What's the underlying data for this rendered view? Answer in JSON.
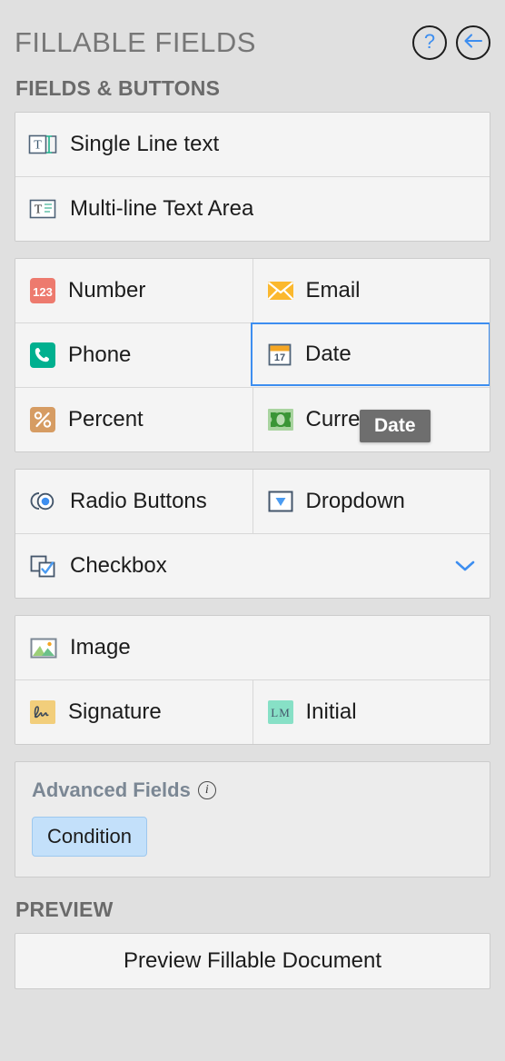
{
  "header": {
    "title": "FILLABLE FIELDS",
    "help_icon": "question-mark-icon",
    "help_label": "?",
    "back_icon": "back-arrow-icon"
  },
  "sections": {
    "fields_buttons_heading": "FIELDS & BUTTONS",
    "preview_heading": "PREVIEW"
  },
  "fields": {
    "single_line_text": {
      "label": "Single Line text",
      "icon": "single-line-text-icon"
    },
    "multi_line_text": {
      "label": "Multi-line Text Area",
      "icon": "multi-line-text-icon"
    },
    "number": {
      "label": "Number",
      "icon": "number-123-icon",
      "color": "#ED7A6E"
    },
    "email": {
      "label": "Email",
      "icon": "envelope-icon",
      "color": "#FBB82E"
    },
    "phone": {
      "label": "Phone",
      "icon": "phone-icon",
      "color": "#00B08F"
    },
    "date": {
      "label": "Date",
      "icon": "calendar-icon",
      "color": "#F5A623",
      "selected": true
    },
    "percent": {
      "label": "Percent",
      "icon": "percent-icon",
      "color": "#D69C63"
    },
    "currency": {
      "label": "Currency",
      "icon": "banknote-icon",
      "color": "#A9D4A0"
    },
    "radio": {
      "label": "Radio Buttons",
      "icon": "radio-button-icon"
    },
    "dropdown": {
      "label": "Dropdown",
      "icon": "dropdown-caret-icon"
    },
    "checkbox": {
      "label": "Checkbox",
      "icon": "checkbox-icon",
      "expand_icon": "chevron-down-icon"
    },
    "image": {
      "label": "Image",
      "icon": "image-icon"
    },
    "signature": {
      "label": "Signature",
      "icon": "signature-icon",
      "color": "#F2CE7B"
    },
    "initial": {
      "label": "Initial",
      "icon": "initial-lm-icon",
      "color": "#87E0C6",
      "glyph": "LM"
    }
  },
  "advanced": {
    "title": "Advanced Fields",
    "info_icon": "info-icon",
    "condition_chip": "Condition"
  },
  "preview": {
    "button_label": "Preview Fillable Document"
  },
  "tooltip": {
    "text": "Date"
  },
  "accent": {
    "selection_blue": "#3d8ef0",
    "panel_bg": "#e0e0e0",
    "row_bg": "#f4f4f4"
  }
}
